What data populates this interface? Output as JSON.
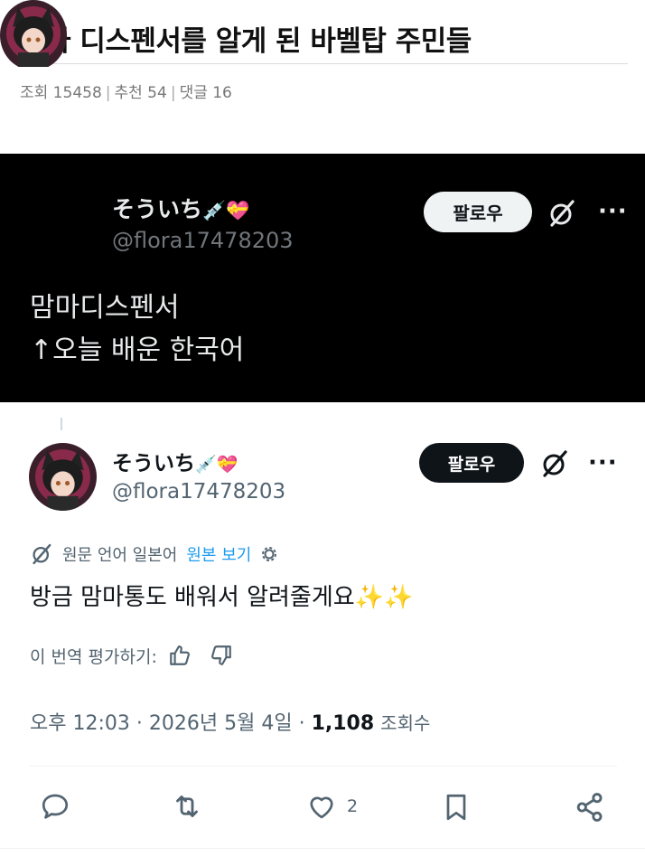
{
  "post": {
    "title": "맘마 디스펜서를 알게 된 바벨탑 주민들",
    "views_label": "조회 15458",
    "recommend_label": "추천 54",
    "comments_label": "댓글 16",
    "separator": "|"
  },
  "tweet_dark": {
    "display_name": "そういち",
    "emoji": "💉💝",
    "handle": "@flora17478203",
    "follow_label": "팔로우",
    "more": "···",
    "line1": "맘마디스펜서",
    "line2": "↑오늘 배운 한국어"
  },
  "tweet_light": {
    "display_name": "そういち",
    "emoji": "💉💝",
    "handle": "@flora17478203",
    "follow_label": "팔로우",
    "more": "···",
    "translation_source": "원문 언어 일본어",
    "show_original": "원본 보기",
    "text": "방금 맘마통도 배워서 알려줄게요✨✨",
    "rate_prompt": "이 번역 평가하기:",
    "time": "오후 12:03",
    "dot": "·",
    "date": "2026년 5월 4일",
    "views_count": "1,108",
    "views_suffix": "조회수",
    "like_count": "2"
  },
  "colors": {
    "link": "#1d9bf0",
    "muted": "#536471",
    "dark_bg": "#000000"
  },
  "icons": [
    "grok-icon",
    "gear-icon",
    "thumbs-up-icon",
    "thumbs-down-icon",
    "reply-icon",
    "retweet-icon",
    "heart-icon",
    "bookmark-icon",
    "share-icon"
  ]
}
